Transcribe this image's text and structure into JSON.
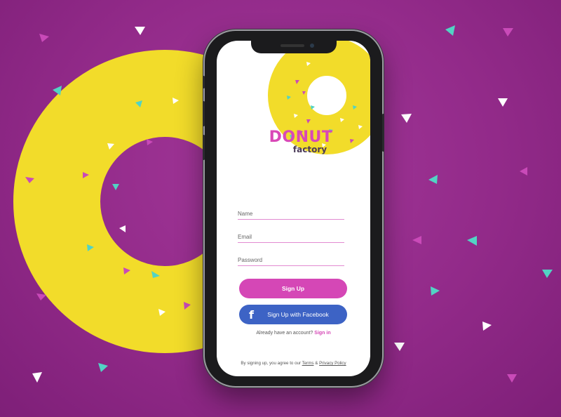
{
  "brand": {
    "title": "DONUT",
    "subtitle": "factory"
  },
  "form": {
    "name_placeholder": "Name",
    "email_placeholder": "Email",
    "password_placeholder": "Password"
  },
  "buttons": {
    "signup_label": "Sign Up",
    "facebook_label": "Sign Up with Facebook",
    "facebook_icon": "facebook-icon"
  },
  "signin_prompt": {
    "text": "Already have an account?",
    "link": "Sign in"
  },
  "legal": {
    "prefix": "By signing up, you agree to our",
    "terms": "Terms",
    "amp": "&",
    "privacy": "Privacy Policy"
  },
  "colors": {
    "background": "#922a89",
    "donut": "#f2dc2a",
    "accent_pink": "#d547b6",
    "facebook_blue": "#3d63c5",
    "sprinkle_teal": "#52d3c4",
    "sprinkle_pink": "#c94ab8",
    "sprinkle_white": "#ffffff"
  }
}
